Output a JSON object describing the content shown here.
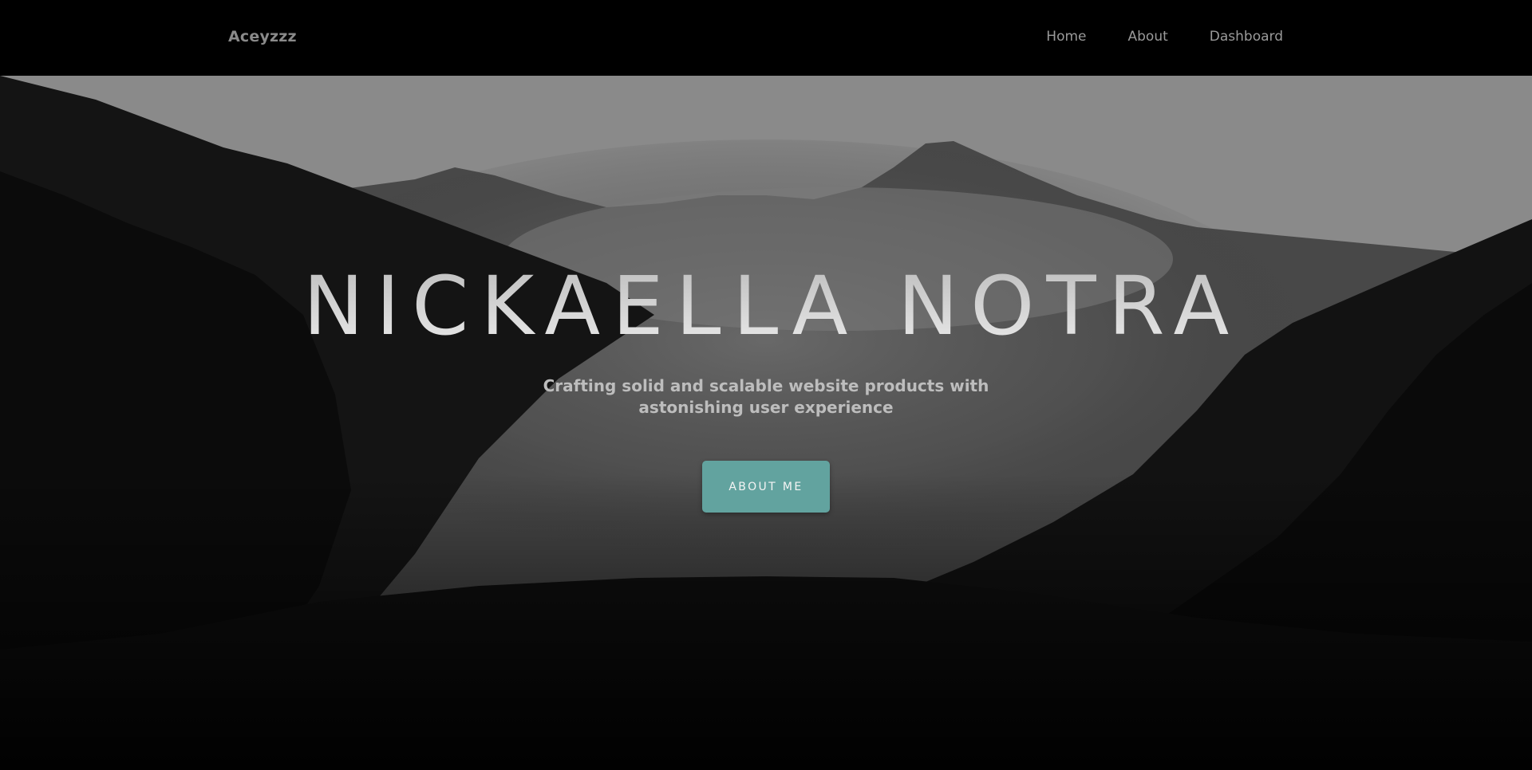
{
  "navbar": {
    "brand": "Aceyzzz",
    "links": [
      {
        "label": "Home"
      },
      {
        "label": "About"
      },
      {
        "label": "Dashboard"
      }
    ]
  },
  "hero": {
    "title": "NICKAELLA NOTRA",
    "subtitle_line1": "Crafting solid and scalable website products with",
    "subtitle_line2": "astonishing user experience",
    "button_label": "ABOUT ME",
    "background": "misty-mountain-forest-photo"
  },
  "colors": {
    "navbar_bg": "#000000",
    "accent": "#62a39f",
    "nav_text": "#9a9a9a",
    "brand_text": "#8a8a8a"
  }
}
